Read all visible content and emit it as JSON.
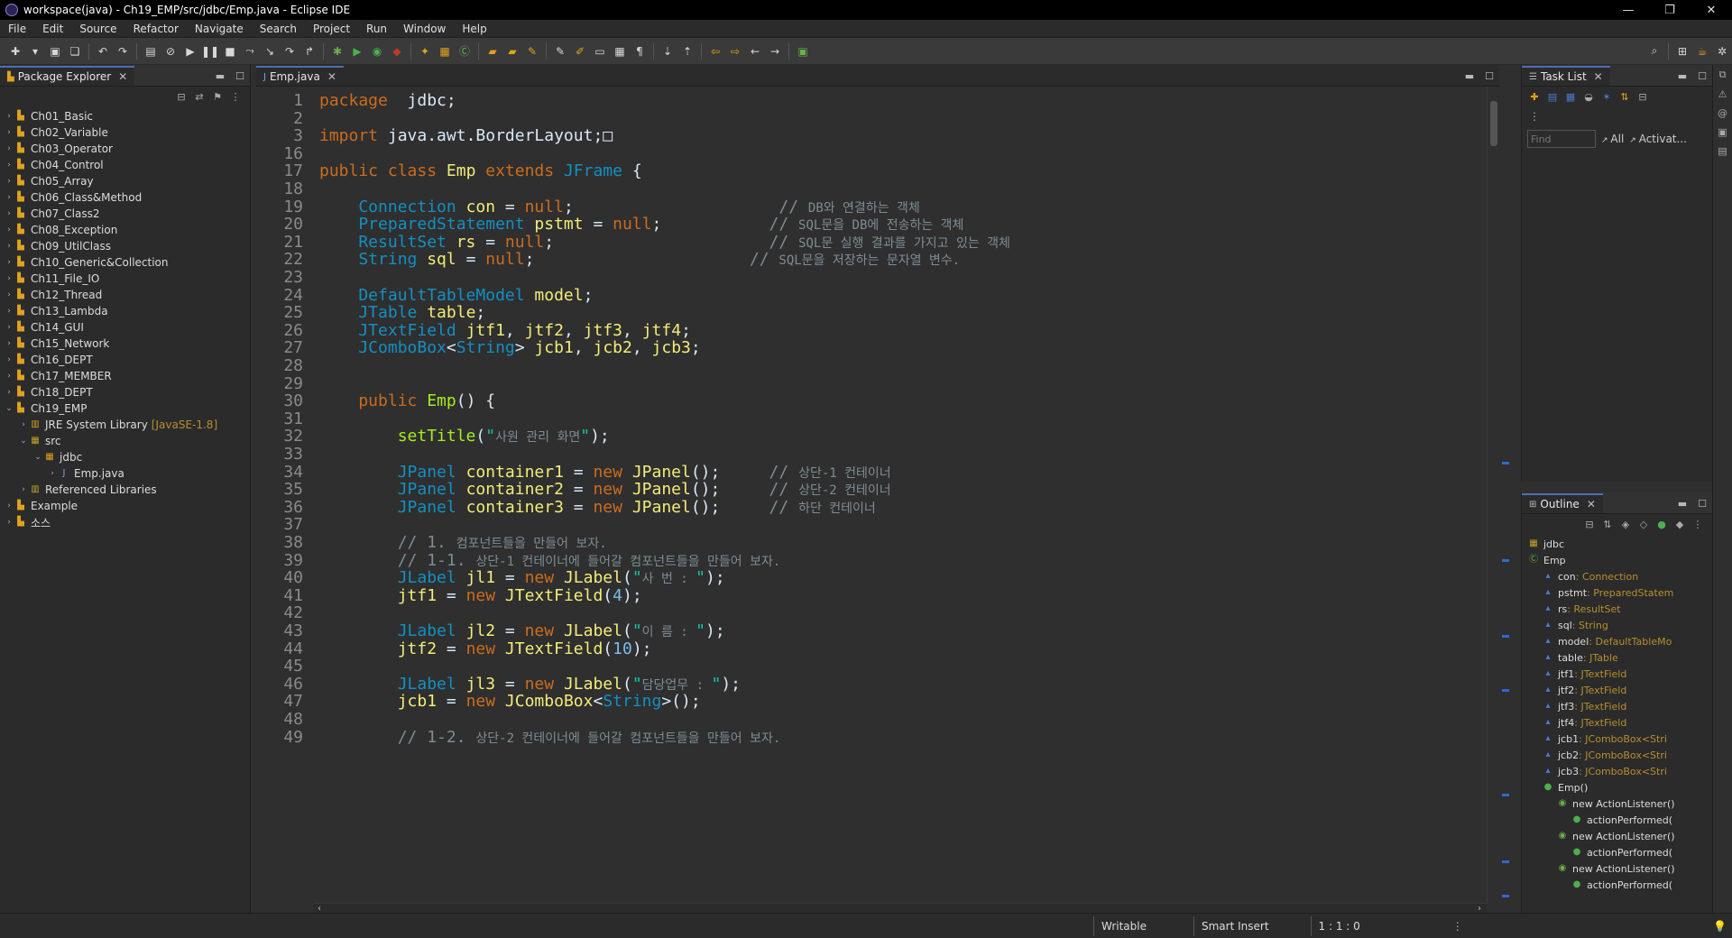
{
  "window": {
    "title": "workspace(java) - Ch19_EMP/src/jdbc/Emp.java - Eclipse IDE"
  },
  "menu": [
    "File",
    "Edit",
    "Source",
    "Refactor",
    "Navigate",
    "Search",
    "Project",
    "Run",
    "Window",
    "Help"
  ],
  "packageExplorer": {
    "title": "Package Explorer",
    "items": [
      {
        "label": "Ch01_Basic",
        "level": 0,
        "arrow": "›"
      },
      {
        "label": "Ch02_Variable",
        "level": 0,
        "arrow": "›"
      },
      {
        "label": "Ch03_Operator",
        "level": 0,
        "arrow": "›"
      },
      {
        "label": "Ch04_Control",
        "level": 0,
        "arrow": "›"
      },
      {
        "label": "Ch05_Array",
        "level": 0,
        "arrow": "›"
      },
      {
        "label": "Ch06_Class&Method",
        "level": 0,
        "arrow": "›"
      },
      {
        "label": "Ch07_Class2",
        "level": 0,
        "arrow": "›"
      },
      {
        "label": "Ch08_Exception",
        "level": 0,
        "arrow": "›"
      },
      {
        "label": "Ch09_UtilClass",
        "level": 0,
        "arrow": "›"
      },
      {
        "label": "Ch10_Generic&Collection",
        "level": 0,
        "arrow": "›"
      },
      {
        "label": "Ch11_File_IO",
        "level": 0,
        "arrow": "›"
      },
      {
        "label": "Ch12_Thread",
        "level": 0,
        "arrow": "›"
      },
      {
        "label": "Ch13_Lambda",
        "level": 0,
        "arrow": "›"
      },
      {
        "label": "Ch14_GUI",
        "level": 0,
        "arrow": "›"
      },
      {
        "label": "Ch15_Network",
        "level": 0,
        "arrow": "›"
      },
      {
        "label": "Ch16_DEPT",
        "level": 0,
        "arrow": "›"
      },
      {
        "label": "Ch17_MEMBER",
        "level": 0,
        "arrow": "›"
      },
      {
        "label": "Ch18_DEPT",
        "level": 0,
        "arrow": "›"
      },
      {
        "label": "Ch19_EMP",
        "level": 0,
        "arrow": "⌄"
      },
      {
        "label": "JRE System Library",
        "deco": "[JavaSE-1.8]",
        "level": 1,
        "arrow": "›"
      },
      {
        "label": "src",
        "level": 1,
        "arrow": "⌄"
      },
      {
        "label": "jdbc",
        "level": 2,
        "arrow": "⌄"
      },
      {
        "label": "Emp.java",
        "level": 3,
        "arrow": "›"
      },
      {
        "label": "Referenced Libraries",
        "level": 1,
        "arrow": "›"
      },
      {
        "label": "Example",
        "level": 0,
        "arrow": "›"
      },
      {
        "label": "소스",
        "level": 0,
        "arrow": "›"
      }
    ]
  },
  "editor": {
    "tab": "Emp.java",
    "lines": [
      {
        "n": "1",
        "code": [
          [
            "kw",
            "package"
          ],
          [
            "",
            "  jdbc;"
          ]
        ]
      },
      {
        "n": "2",
        "code": []
      },
      {
        "n": "3",
        "code": [
          [
            "kw",
            "import"
          ],
          [
            "",
            " java.awt.BorderLayout;□"
          ]
        ]
      },
      {
        "n": "16",
        "code": []
      },
      {
        "n": "17",
        "code": [
          [
            "kw",
            "public class "
          ],
          [
            "vr",
            "Emp"
          ],
          [
            "kw",
            " extends "
          ],
          [
            "ty",
            "JFrame"
          ],
          [
            "",
            " {"
          ]
        ]
      },
      {
        "n": "18",
        "code": []
      },
      {
        "n": "19",
        "code": [
          [
            "ty",
            "    Connection "
          ],
          [
            "vr",
            "con"
          ],
          [
            "",
            " = "
          ],
          [
            "kw",
            "null"
          ],
          [
            "",
            ";"
          ],
          [
            "cm",
            "                     // "
          ],
          [
            "cmk",
            "DB와 연결하는 객체"
          ]
        ]
      },
      {
        "n": "20",
        "code": [
          [
            "ty",
            "    PreparedStatement "
          ],
          [
            "vr",
            "pstmt"
          ],
          [
            "",
            " = "
          ],
          [
            "kw",
            "null"
          ],
          [
            "",
            ";"
          ],
          [
            "cm",
            "           // "
          ],
          [
            "cmk",
            "SQL문을 DB에 전송하는 객체"
          ]
        ]
      },
      {
        "n": "21",
        "code": [
          [
            "ty",
            "    ResultSet "
          ],
          [
            "vr",
            "rs"
          ],
          [
            "",
            " = "
          ],
          [
            "kw",
            "null"
          ],
          [
            "",
            ";"
          ],
          [
            "cm",
            "                      // "
          ],
          [
            "cmk",
            "SQL문 실행 결과를 가지고 있는 객체"
          ]
        ]
      },
      {
        "n": "22",
        "code": [
          [
            "ty",
            "    String "
          ],
          [
            "vr",
            "sql"
          ],
          [
            "",
            " = "
          ],
          [
            "kw",
            "null"
          ],
          [
            "",
            ";"
          ],
          [
            "cm",
            "                      // "
          ],
          [
            "cmk",
            "SQL문을 저장하는 문자열 변수."
          ]
        ]
      },
      {
        "n": "23",
        "code": []
      },
      {
        "n": "24",
        "code": [
          [
            "ty",
            "    DefaultTableModel "
          ],
          [
            "vr",
            "model"
          ],
          [
            "",
            ";"
          ]
        ]
      },
      {
        "n": "25",
        "code": [
          [
            "ty",
            "    JTable "
          ],
          [
            "vr",
            "table"
          ],
          [
            "",
            ";"
          ]
        ]
      },
      {
        "n": "26",
        "code": [
          [
            "ty",
            "    JTextField "
          ],
          [
            "vr",
            "jtf1"
          ],
          [
            "",
            ", "
          ],
          [
            "vr",
            "jtf2"
          ],
          [
            "",
            ", "
          ],
          [
            "vr",
            "jtf3"
          ],
          [
            "",
            ", "
          ],
          [
            "vr",
            "jtf4"
          ],
          [
            "",
            ";"
          ]
        ]
      },
      {
        "n": "27",
        "code": [
          [
            "ty",
            "    JComboBox"
          ],
          [
            "",
            "<"
          ],
          [
            "ty",
            "String"
          ],
          [
            "",
            "> "
          ],
          [
            "vr",
            "jcb1"
          ],
          [
            "",
            ", "
          ],
          [
            "vr",
            "jcb2"
          ],
          [
            "",
            ", "
          ],
          [
            "vr",
            "jcb3"
          ],
          [
            "",
            ";"
          ]
        ]
      },
      {
        "n": "28",
        "code": []
      },
      {
        "n": "29",
        "code": []
      },
      {
        "n": "30",
        "code": [
          [
            "kw",
            "    public "
          ],
          [
            "fn",
            "Emp"
          ],
          [
            "",
            "() {"
          ]
        ]
      },
      {
        "n": "31",
        "code": []
      },
      {
        "n": "32",
        "code": [
          [
            "fn",
            "        setTitle"
          ],
          [
            "",
            "("
          ],
          [
            "st",
            "\""
          ],
          [
            "cmk",
            "사원 관리 화면"
          ],
          [
            "st",
            "\""
          ],
          [
            "",
            ");"
          ]
        ]
      },
      {
        "n": "33",
        "code": []
      },
      {
        "n": "34",
        "code": [
          [
            "ty",
            "        JPanel "
          ],
          [
            "vr",
            "container1"
          ],
          [
            "",
            " = "
          ],
          [
            "kw",
            "new "
          ],
          [
            "vr",
            "JPanel"
          ],
          [
            "",
            "();"
          ],
          [
            "cm",
            "     // "
          ],
          [
            "cmk",
            "상단-1 컨테이너"
          ]
        ]
      },
      {
        "n": "35",
        "code": [
          [
            "ty",
            "        JPanel "
          ],
          [
            "vr",
            "container2"
          ],
          [
            "",
            " = "
          ],
          [
            "kw",
            "new "
          ],
          [
            "vr",
            "JPanel"
          ],
          [
            "",
            "();"
          ],
          [
            "cm",
            "     // "
          ],
          [
            "cmk",
            "상단-2 컨테이너"
          ]
        ]
      },
      {
        "n": "36",
        "code": [
          [
            "ty",
            "        JPanel "
          ],
          [
            "vr",
            "container3"
          ],
          [
            "",
            " = "
          ],
          [
            "kw",
            "new "
          ],
          [
            "vr",
            "JPanel"
          ],
          [
            "",
            "();"
          ],
          [
            "cm",
            "     // "
          ],
          [
            "cmk",
            "하단 컨테이너"
          ]
        ]
      },
      {
        "n": "37",
        "code": []
      },
      {
        "n": "38",
        "code": [
          [
            "cm",
            "        // 1. "
          ],
          [
            "cmk",
            "컴포넌트들을 만들어 보자."
          ]
        ]
      },
      {
        "n": "39",
        "code": [
          [
            "cm",
            "        // 1-1. "
          ],
          [
            "cmk",
            "상단-1 컨테이너에 들어갈 컴포넌트들을 만들어 보자."
          ]
        ]
      },
      {
        "n": "40",
        "code": [
          [
            "ty",
            "        JLabel "
          ],
          [
            "vr",
            "jl1"
          ],
          [
            "",
            " = "
          ],
          [
            "kw",
            "new "
          ],
          [
            "vr",
            "JLabel"
          ],
          [
            "",
            "("
          ],
          [
            "st",
            "\""
          ],
          [
            "cmk",
            "사 번 : "
          ],
          [
            "st",
            "\""
          ],
          [
            "",
            ");"
          ]
        ]
      },
      {
        "n": "41",
        "code": [
          [
            "vr",
            "        jtf1"
          ],
          [
            "",
            " = "
          ],
          [
            "kw",
            "new "
          ],
          [
            "vr",
            "JTextField"
          ],
          [
            "",
            "("
          ],
          [
            "nu",
            "4"
          ],
          [
            "",
            ");"
          ]
        ]
      },
      {
        "n": "42",
        "code": []
      },
      {
        "n": "43",
        "code": [
          [
            "ty",
            "        JLabel "
          ],
          [
            "vr",
            "jl2"
          ],
          [
            "",
            " = "
          ],
          [
            "kw",
            "new "
          ],
          [
            "vr",
            "JLabel"
          ],
          [
            "",
            "("
          ],
          [
            "st",
            "\""
          ],
          [
            "cmk",
            "이 름 : "
          ],
          [
            "st",
            "\""
          ],
          [
            "",
            ");"
          ]
        ]
      },
      {
        "n": "44",
        "code": [
          [
            "vr",
            "        jtf2"
          ],
          [
            "",
            " = "
          ],
          [
            "kw",
            "new "
          ],
          [
            "vr",
            "JTextField"
          ],
          [
            "",
            "("
          ],
          [
            "nu",
            "10"
          ],
          [
            "",
            ");"
          ]
        ]
      },
      {
        "n": "45",
        "code": []
      },
      {
        "n": "46",
        "code": [
          [
            "ty",
            "        JLabel "
          ],
          [
            "vr",
            "jl3"
          ],
          [
            "",
            " = "
          ],
          [
            "kw",
            "new "
          ],
          [
            "vr",
            "JLabel"
          ],
          [
            "",
            "("
          ],
          [
            "st",
            "\""
          ],
          [
            "cmk",
            "담당업무 : "
          ],
          [
            "st",
            "\""
          ],
          [
            "",
            ");"
          ]
        ]
      },
      {
        "n": "47",
        "code": [
          [
            "vr",
            "        jcb1"
          ],
          [
            "",
            " = "
          ],
          [
            "kw",
            "new "
          ],
          [
            "vr",
            "JComboBox"
          ],
          [
            "",
            "<"
          ],
          [
            "ty",
            "String"
          ],
          [
            "",
            ">();"
          ]
        ]
      },
      {
        "n": "48",
        "code": []
      },
      {
        "n": "49",
        "code": [
          [
            "cm",
            "        // 1-2. "
          ],
          [
            "cmk",
            "상단-2 컨테이너에 들어갈 컴포넌트들을 만들어 보자."
          ]
        ]
      }
    ]
  },
  "taskList": {
    "title": "Task List",
    "find_placeholder": "Find",
    "all_label": "All",
    "activate_label": "Activat..."
  },
  "outline": {
    "title": "Outline",
    "items": [
      {
        "label": "jdbc",
        "type": "",
        "level": 0
      },
      {
        "label": "Emp",
        "type": "",
        "level": 0
      },
      {
        "label": "con",
        "type": " : Connection",
        "level": 1
      },
      {
        "label": "pstmt",
        "type": " : PreparedStatem",
        "level": 1
      },
      {
        "label": "rs",
        "type": " : ResultSet",
        "level": 1
      },
      {
        "label": "sql",
        "type": " : String",
        "level": 1
      },
      {
        "label": "model",
        "type": " : DefaultTableMo",
        "level": 1
      },
      {
        "label": "table",
        "type": " : JTable",
        "level": 1
      },
      {
        "label": "jtf1",
        "type": " : JTextField",
        "level": 1
      },
      {
        "label": "jtf2",
        "type": " : JTextField",
        "level": 1
      },
      {
        "label": "jtf3",
        "type": " : JTextField",
        "level": 1
      },
      {
        "label": "jtf4",
        "type": " : JTextField",
        "level": 1
      },
      {
        "label": "jcb1",
        "type": " : JComboBox<Stri",
        "level": 1
      },
      {
        "label": "jcb2",
        "type": " : JComboBox<Stri",
        "level": 1
      },
      {
        "label": "jcb3",
        "type": " : JComboBox<Stri",
        "level": 1
      },
      {
        "label": "Emp()",
        "type": "",
        "level": 1
      },
      {
        "label": "new ActionListener()",
        "type": "",
        "level": 2
      },
      {
        "label": "actionPerformed(",
        "type": "",
        "level": 3
      },
      {
        "label": "new ActionListener()",
        "type": "",
        "level": 2
      },
      {
        "label": "actionPerformed(",
        "type": "",
        "level": 3
      },
      {
        "label": "new ActionListener()",
        "type": "",
        "level": 2
      },
      {
        "label": "actionPerformed(",
        "type": "",
        "level": 3
      }
    ]
  },
  "status": {
    "writable": "Writable",
    "insert": "Smart Insert",
    "position": "1 : 1 : 0"
  },
  "colors": {
    "keyword": "#cc6c1d",
    "type": "#1290c3",
    "variable": "#f3ec79",
    "comment": "#7d8c93",
    "string": "#17c6a3",
    "method": "#a7ec21",
    "number": "#7bbde8",
    "accent": "#4c6fb0"
  }
}
